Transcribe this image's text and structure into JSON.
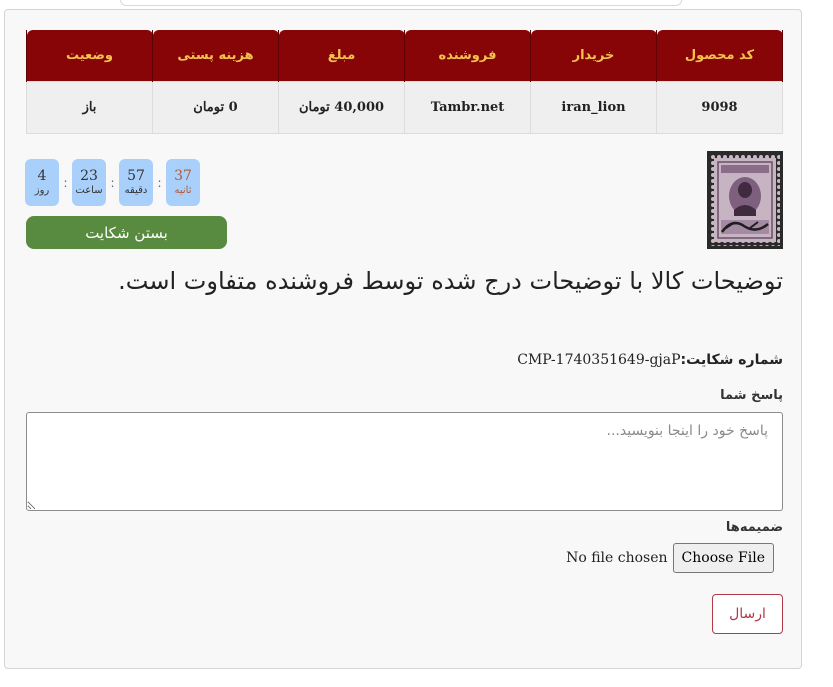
{
  "table": {
    "headers": [
      "کد محصول",
      "خریدار",
      "فروشنده",
      "مبلغ",
      "هزینه پستی",
      "وضعیت"
    ],
    "row": [
      "9098",
      "iran_lion",
      "Tambr.net",
      "40,000 تومان",
      "0 تومان",
      "باز"
    ]
  },
  "timer": {
    "seconds": {
      "value": "37",
      "label": "ثانیه"
    },
    "minutes": {
      "value": "57",
      "label": "دقیقه"
    },
    "hours": {
      "value": "23",
      "label": "ساعت"
    },
    "days": {
      "value": "4",
      "label": "روز"
    },
    "separator": ":"
  },
  "actions": {
    "close_complaint": "بستن شکایت",
    "send": "ارسال"
  },
  "complaint": {
    "title": "توضیحات کالا با توضیحات درج شده توسط فروشنده متفاوت است.",
    "number_label": "شماره شکایت:",
    "number_value": "CMP-1740351649-gjaP"
  },
  "reply": {
    "label": "پاسخ شما",
    "placeholder": "پاسخ خود را اینجا بنویسید..."
  },
  "attachments": {
    "label": "ضمیمه‌ها",
    "button": "Choose File",
    "status": "No file chosen"
  },
  "colors": {
    "header_bg": "#870507",
    "header_text": "#f3c34c",
    "timer_bg": "#a8d0fb",
    "close_button": "#588a40",
    "send_border": "#b03a48"
  }
}
